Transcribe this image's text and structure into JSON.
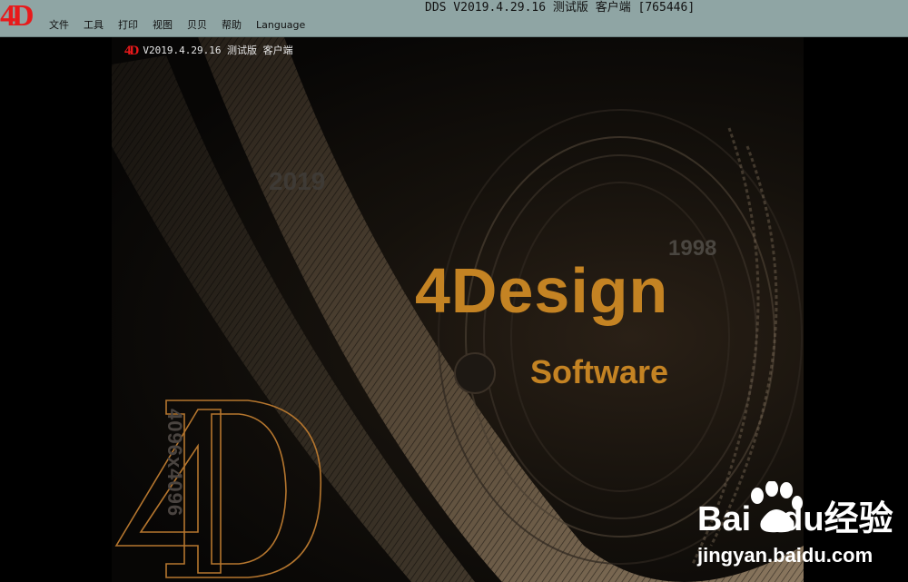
{
  "window": {
    "logo_text": "4D",
    "title": "DDS  V2019.4.29.16 测试版 客户端 [765446]"
  },
  "menu": [
    {
      "label": "文件"
    },
    {
      "label": "工具"
    },
    {
      "label": "打印"
    },
    {
      "label": "视图"
    },
    {
      "label": "贝贝"
    },
    {
      "label": "帮助"
    },
    {
      "label": "Language"
    }
  ],
  "splash": {
    "mini_logo": "4D",
    "version": "V2019.4.29.16 测试版 客户端",
    "year_left": "2019",
    "year_right": "1998",
    "brand": "4Design",
    "subtitle": "Software",
    "resolution": "4096x4096",
    "big_logo": "4D"
  },
  "watermark": {
    "brand_left": "Bai",
    "brand_right": "经验",
    "url": "jingyan.baidu.com"
  },
  "colors": {
    "titlebar": "#8fa5a4",
    "logo_red": "#e8191b",
    "brand_orange": "#c48323"
  }
}
